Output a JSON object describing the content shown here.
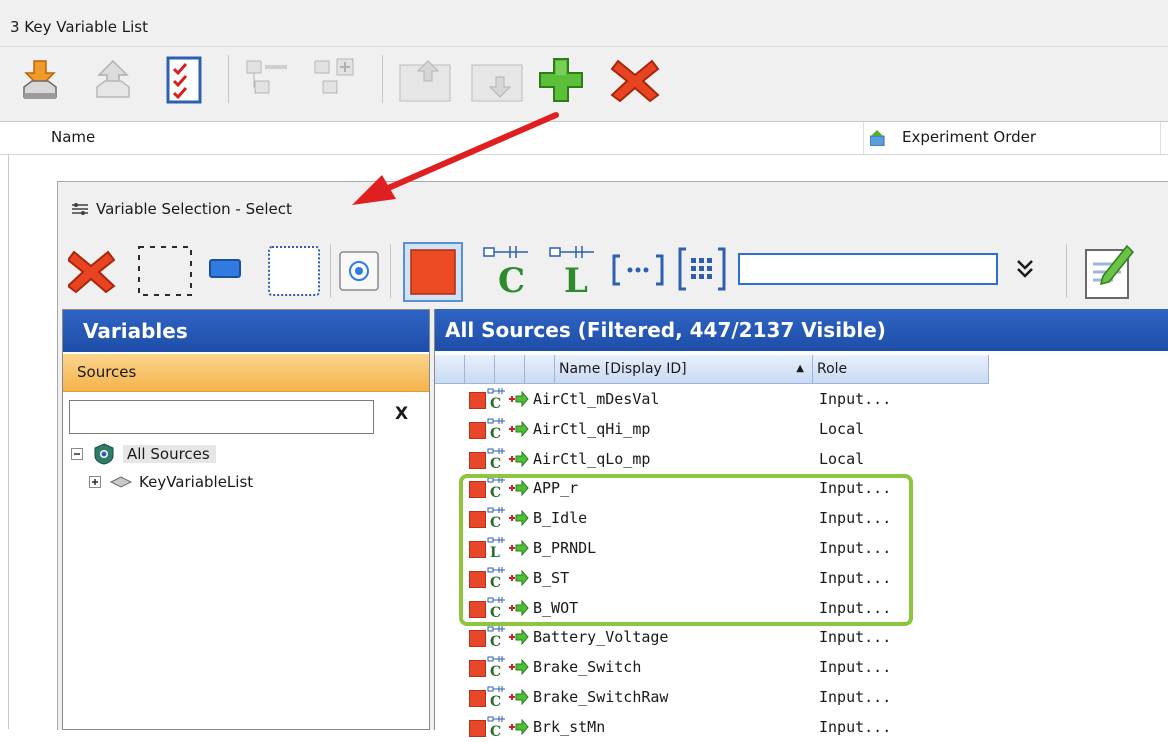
{
  "outer": {
    "title": "3 Key Variable List",
    "columns": {
      "name": "Name",
      "experiment_order": "Experiment Order"
    }
  },
  "dialog": {
    "title": "Variable Selection - Select",
    "filter_value": ""
  },
  "variables_panel": {
    "header": "Variables",
    "sources_label": "Sources",
    "search_value": "",
    "clear_label": "X",
    "tree": [
      {
        "label": "All Sources",
        "expander": "−"
      },
      {
        "label": "KeyVariableList",
        "expander": "+"
      }
    ]
  },
  "sources_panel": {
    "header": "All Sources (Filtered, 447/2137 Visible)",
    "columns": {
      "name": "Name [Display ID]",
      "sort_indicator": "▲",
      "role": "Role"
    },
    "rows": [
      {
        "name": "AirCtl_mDesVal",
        "role": "Input...",
        "kind": "C"
      },
      {
        "name": "AirCtl_qHi_mp",
        "role": "Local",
        "kind": "C"
      },
      {
        "name": "AirCtl_qLo_mp",
        "role": "Local",
        "kind": "C"
      },
      {
        "name": "APP_r",
        "role": "Input...",
        "kind": "C"
      },
      {
        "name": "B_Idle",
        "role": "Input...",
        "kind": "C"
      },
      {
        "name": "B_PRNDL",
        "role": "Input...",
        "kind": "L"
      },
      {
        "name": "B_ST",
        "role": "Input...",
        "kind": "C"
      },
      {
        "name": "B_WOT",
        "role": "Input...",
        "kind": "C"
      },
      {
        "name": "Battery_Voltage",
        "role": "Input...",
        "kind": "C"
      },
      {
        "name": "Brake_Switch",
        "role": "Input...",
        "kind": "C"
      },
      {
        "name": "Brake_SwitchRaw",
        "role": "Input...",
        "kind": "C"
      },
      {
        "name": "Brk_stMn",
        "role": "Input...",
        "kind": "C"
      }
    ]
  },
  "colors": {
    "header_blue": "#1e4ea8",
    "sources_orange": "#f4b34a",
    "highlight_green": "#8cc63f",
    "annotation_red": "#e02020",
    "item_red": "#e8472a"
  }
}
